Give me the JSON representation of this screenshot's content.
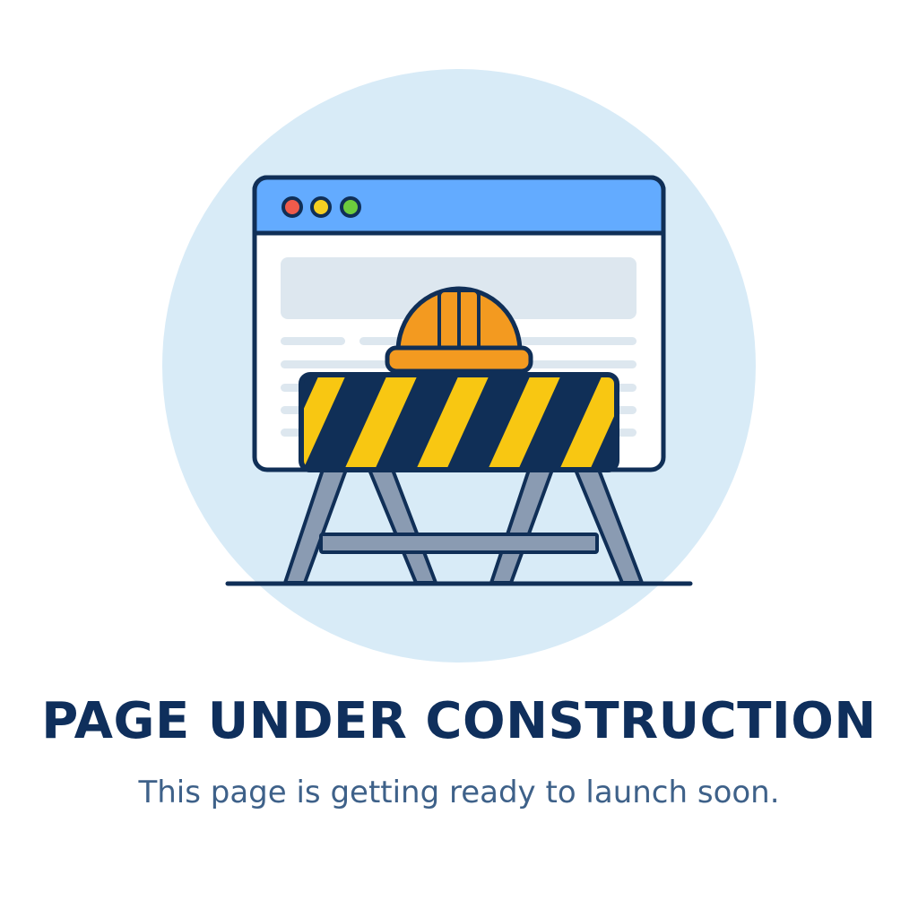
{
  "headline": "PAGE UNDER CONSTRUCTION",
  "subtext": "This page is getting ready to launch soon.",
  "colors": {
    "headline": "#0f2f5c",
    "subtext": "#3e6189",
    "circle_background": "#d8ebf7",
    "browser_titlebar": "#63abff",
    "browser_outline": "#102f57",
    "hard_hat": "#f39a20",
    "barrier_stripe_yellow": "#f8c712",
    "barrier_stripe_navy": "#102f57",
    "barrier_legs": "#8a9bb2",
    "window_dot_red": "#ef5b4b",
    "window_dot_yellow": "#f5cf22",
    "window_dot_green": "#6dcc3d"
  },
  "icons": {
    "browser": "browser-window-icon",
    "hard_hat": "hard-hat-icon",
    "barrier": "construction-barrier-icon"
  }
}
